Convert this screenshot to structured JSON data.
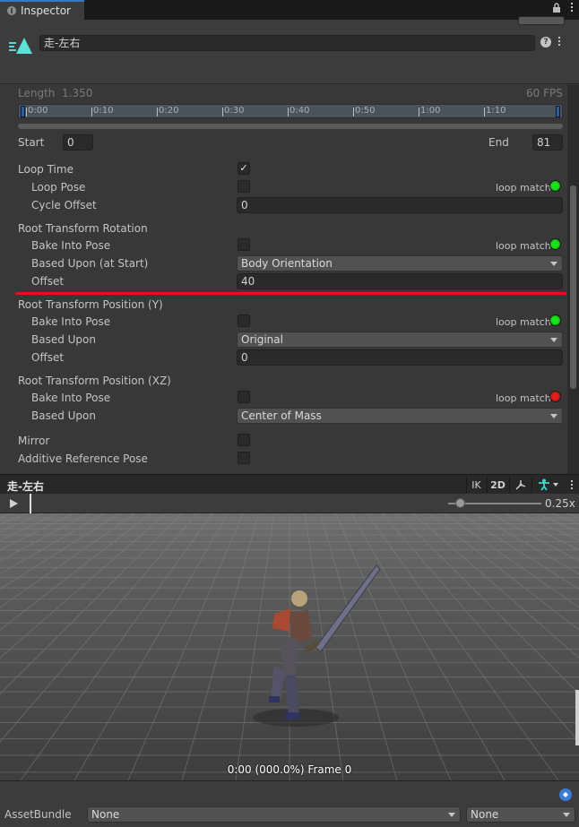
{
  "tab": {
    "title": "Inspector"
  },
  "asset": {
    "name": "走-左右"
  },
  "clip": {
    "length_label": "Length",
    "length_value": "1.350",
    "fps": "60 FPS",
    "timeline_ticks": [
      "0:00",
      "0:10",
      "0:20",
      "0:30",
      "0:40",
      "0:50",
      "1:00",
      "1:10"
    ],
    "start_label": "Start",
    "start_value": "0",
    "end_label": "End",
    "end_value": "81"
  },
  "settings": {
    "loop_time": {
      "label": "Loop Time",
      "checked": true
    },
    "loop_pose": {
      "label": "Loop Pose",
      "checked": false,
      "match_label": "loop match",
      "status": "green"
    },
    "cycle_offset": {
      "label": "Cycle Offset",
      "value": "0"
    },
    "rot": {
      "header": "Root Transform Rotation",
      "bake_label": "Bake Into Pose",
      "bake_checked": false,
      "match_label": "loop match",
      "status": "green",
      "based_label": "Based Upon (at Start)",
      "based_value": "Body Orientation",
      "offset_label": "Offset",
      "offset_value": "40"
    },
    "posy": {
      "header": "Root Transform Position (Y)",
      "bake_label": "Bake Into Pose",
      "bake_checked": false,
      "match_label": "loop match",
      "status": "green",
      "based_label": "Based Upon",
      "based_value": "Original",
      "offset_label": "Offset",
      "offset_value": "0"
    },
    "posxz": {
      "header": "Root Transform Position (XZ)",
      "bake_label": "Bake Into Pose",
      "bake_checked": false,
      "match_label": "loop match",
      "status": "red",
      "based_label": "Based Upon",
      "based_value": "Center of Mass"
    },
    "mirror": {
      "label": "Mirror",
      "checked": false
    },
    "additive": {
      "label": "Additive Reference Pose",
      "checked": false
    }
  },
  "status_colors": {
    "green": "#19e419",
    "red": "#e01e1e",
    "highlight_line": "#e0131b"
  },
  "preview": {
    "title": "走-左右",
    "ik_label": "IK",
    "mode_label": "2D",
    "speed_label": "0.25x",
    "speed_fraction": 0.1,
    "status": "0:00 (000.0%) Frame 0"
  },
  "footer": {
    "assetbundle_label": "AssetBundle",
    "bundle_value": "None",
    "variant_value": "None"
  }
}
